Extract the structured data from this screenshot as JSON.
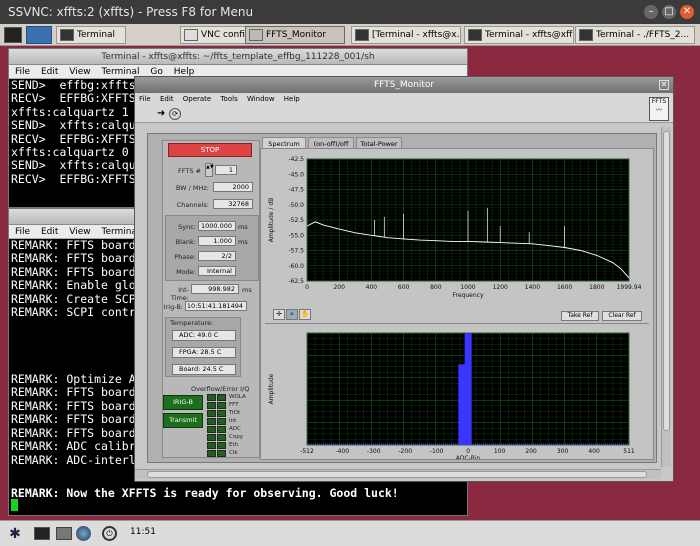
{
  "vnc": {
    "title": "SSVNC: xffts:2 (xffts) - Press F8 for Menu"
  },
  "taskbar": {
    "tasks": [
      {
        "label": "Terminal"
      },
      {
        "label": "VNC config"
      },
      {
        "label": "FFTS_Monitor"
      },
      {
        "label": "[Terminal - xffts@x..."
      },
      {
        "label": "Terminal - xffts@xff..."
      },
      {
        "label": "Terminal - ./FFTS_2..."
      }
    ]
  },
  "term1": {
    "title": "Terminal - xffts@xffts: ~/ffts_template_effbg_111228_001/sh",
    "menu": [
      "File",
      "Edit",
      "View",
      "Terminal",
      "Go",
      "Help"
    ],
    "lines": [
      "SEND>  effbg:xffts",
      "RECV>  EFFBG:XFFTS",
      "xffts:calquartz 1",
      "SEND>  xffts:calqu",
      "RECV>  EFFBG:XFFTS",
      "xffts:calquartz 0",
      "SEND>  xffts:calqu",
      "RECV>  EFFBG:XFFTS"
    ]
  },
  "term2": {
    "menu": [
      "File",
      "Edit",
      "View",
      "Terminal"
    ],
    "lines": [
      "REMARK: FFTS board",
      "REMARK: FFTS board",
      "REMARK: FFTS board",
      "REMARK: Enable glo",
      "REMARK: Create SCP",
      "REMARK: SCPI contr",
      "",
      "",
      "",
      "",
      "REMARK: Optimize A",
      "REMARK: FFTS board",
      "REMARK: FFTS board",
      "REMARK: FFTS board",
      "REMARK: FFTS board",
      "REMARK: ADC calibr",
      "REMARK: ADC-interl"
    ],
    "final_line": "REMARK: Now the XFFTS is ready for observing. Good luck!"
  },
  "ffts": {
    "title": "FFTS_Monitor",
    "menu": [
      "File",
      "Edit",
      "Operate",
      "Tools",
      "Window",
      "Help"
    ],
    "logo": "FFTS",
    "stop_label": "STOP",
    "ffts_num_label": "FFTS #",
    "ffts_num": "1",
    "bw_label": "BW / MHz:",
    "bw": "2000",
    "channels_label": "Channels:",
    "channels": "32768",
    "sync_label": "Sync:",
    "sync": "1000.000",
    "sync_unit": "ms",
    "blank_label": "Blank:",
    "blank": "1.000",
    "blank_unit": "ms",
    "phase_label": "Phase:",
    "phase": "2/2",
    "mode_label": "Mode:",
    "mode": "Internal",
    "inttime_label": "Int-Time:",
    "inttime": "998.982",
    "inttime_unit": "ms",
    "irig_label": "Irig-B:",
    "irig": "10:51:41.181494",
    "temp_title": "Temperature:",
    "adc_temp": "ADC: 49.0 C",
    "fpga_temp": "FPGA: 28.5 C",
    "board_temp": "Board: 24.5 C",
    "overflow_title": "Overflow/Error I/Q",
    "irig_btn": "IRIG-B",
    "transmit_btn": "Transmit",
    "flags": [
      "WOLA",
      "FFT",
      "TrDt",
      "Int",
      "ADC",
      "Copy",
      "Eth",
      "Clk"
    ],
    "tabs": [
      "Spectrum",
      "(on-off)/off",
      "Total-Power"
    ],
    "take_ref": "Take Ref",
    "clear_ref": "Clear Ref"
  },
  "spectrum": {
    "ylabel": "Amplitude / dB",
    "xlabel": "Frequency",
    "yticks": [
      "-42.5",
      "-45.0",
      "-47.5",
      "-50.0",
      "-52.5",
      "-55.0",
      "-57.5",
      "-60.0",
      "-62.5"
    ],
    "xticks": [
      "0",
      "200",
      "400",
      "600",
      "800",
      "1000",
      "1200",
      "1400",
      "1600",
      "1800",
      "1999.94"
    ]
  },
  "chart_data": [
    {
      "type": "line",
      "title": "",
      "xlabel": "Frequency",
      "ylabel": "Amplitude / dB",
      "xlim": [
        0,
        1999.94
      ],
      "ylim": [
        -62.5,
        -42.5
      ],
      "grid": true,
      "x": [
        0,
        50,
        100,
        200,
        300,
        400,
        500,
        600,
        700,
        800,
        900,
        1000,
        1100,
        1200,
        1300,
        1400,
        1500,
        1600,
        1700,
        1800,
        1900,
        1950,
        1999.94
      ],
      "y": [
        -53.5,
        -52.8,
        -53.3,
        -54.0,
        -54.6,
        -55.0,
        -55.4,
        -55.6,
        -55.8,
        -55.9,
        -56.0,
        -56.0,
        -56.1,
        -56.2,
        -56.3,
        -56.4,
        -56.7,
        -57.0,
        -57.5,
        -58.3,
        -59.5,
        -60.5,
        -62.0
      ],
      "spikes": [
        {
          "x": 420,
          "y": -52.5
        },
        {
          "x": 480,
          "y": -52.0
        },
        {
          "x": 600,
          "y": -51.5
        },
        {
          "x": 1000,
          "y": -51.0
        },
        {
          "x": 1120,
          "y": -50.5
        },
        {
          "x": 1200,
          "y": -53.5
        },
        {
          "x": 1380,
          "y": -54.5
        },
        {
          "x": 1600,
          "y": -53.5
        }
      ]
    },
    {
      "type": "bar",
      "title": "",
      "xlabel": "ADC-Bin",
      "ylabel": "Amplitude",
      "xlim": [
        -512,
        511
      ],
      "ylim": [
        0,
        1
      ],
      "grid": true,
      "xticks": [
        "-512",
        "-400",
        "-300",
        "-200",
        "-100",
        "0",
        "100",
        "200",
        "300",
        "400",
        "511"
      ],
      "x": [
        -20,
        0
      ],
      "values": [
        0.72,
        1.0
      ],
      "color": "#3a36ff"
    }
  ],
  "clock": {
    "time": "11:51"
  }
}
